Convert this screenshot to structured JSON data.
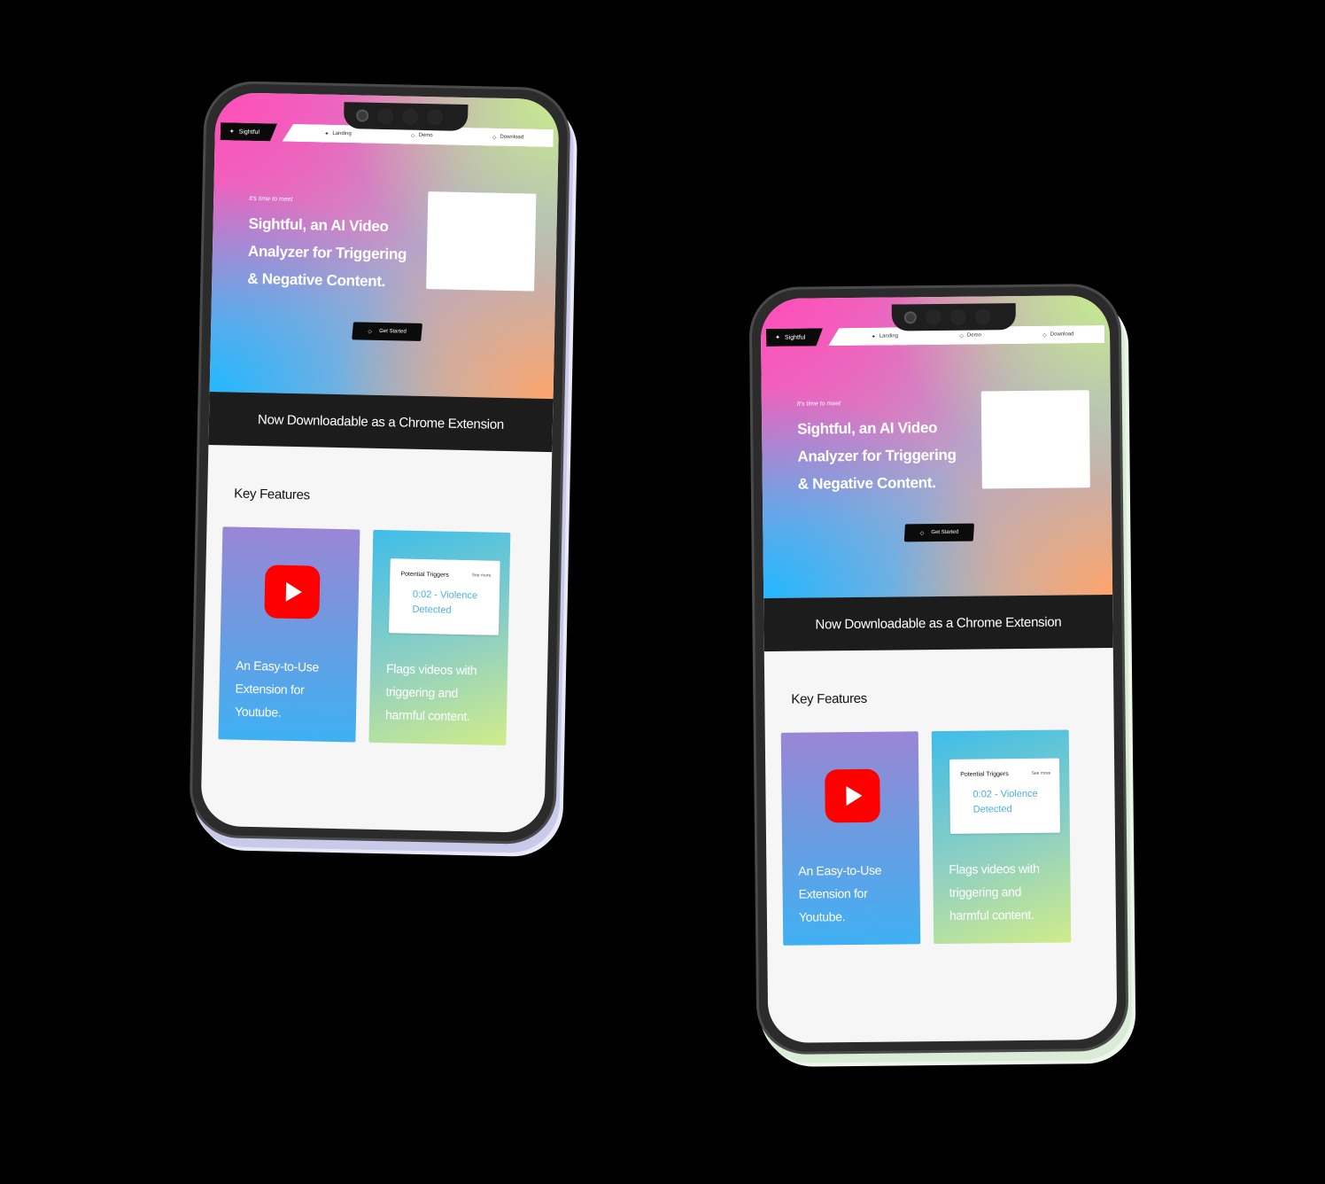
{
  "phones": [
    {
      "nav": {
        "brand": "Sightful",
        "items": [
          "Landing",
          "Demo",
          "Download"
        ]
      },
      "hero": {
        "tagline": "It's time to meet",
        "headline": "Sightful, an AI Video Analyzer for Triggering & Negative Content.",
        "cta": "Get Started"
      },
      "banner": "Now Downloadable as a Chrome Extension",
      "features": {
        "title": "Key Features",
        "cards": [
          {
            "text": "An Easy-to-Use Extension for Youtube.",
            "icon": "youtube-play-icon"
          },
          {
            "text": "Flags videos with triggering and harmful content.",
            "panel_title": "Potential Triggers",
            "panel_link": "See more",
            "panel_body": "0:02 - Violence Detected"
          }
        ]
      }
    },
    {
      "nav": {
        "brand": "Sightful",
        "items": [
          "Landing",
          "Demo",
          "Download"
        ]
      },
      "hero": {
        "tagline": "It's time to meet",
        "headline": "Sightful, an AI Video Analyzer for Triggering & Negative Content.",
        "cta": "Get Started"
      },
      "banner": "Now Downloadable as a Chrome Extension",
      "features": {
        "title": "Key Features",
        "cards": [
          {
            "text": "An Easy-to-Use Extension for Youtube.",
            "icon": "youtube-play-icon"
          },
          {
            "text": "Flags videos with triggering and harmful content.",
            "panel_title": "Potential Triggers",
            "panel_link": "See more",
            "panel_body": "0:02 - Violence Detected"
          }
        ]
      }
    }
  ],
  "colors": {
    "background": "#000000",
    "banner": "#1c1c1c",
    "youtube_red": "#ff0000",
    "detected_text": "#4ab0e0"
  }
}
